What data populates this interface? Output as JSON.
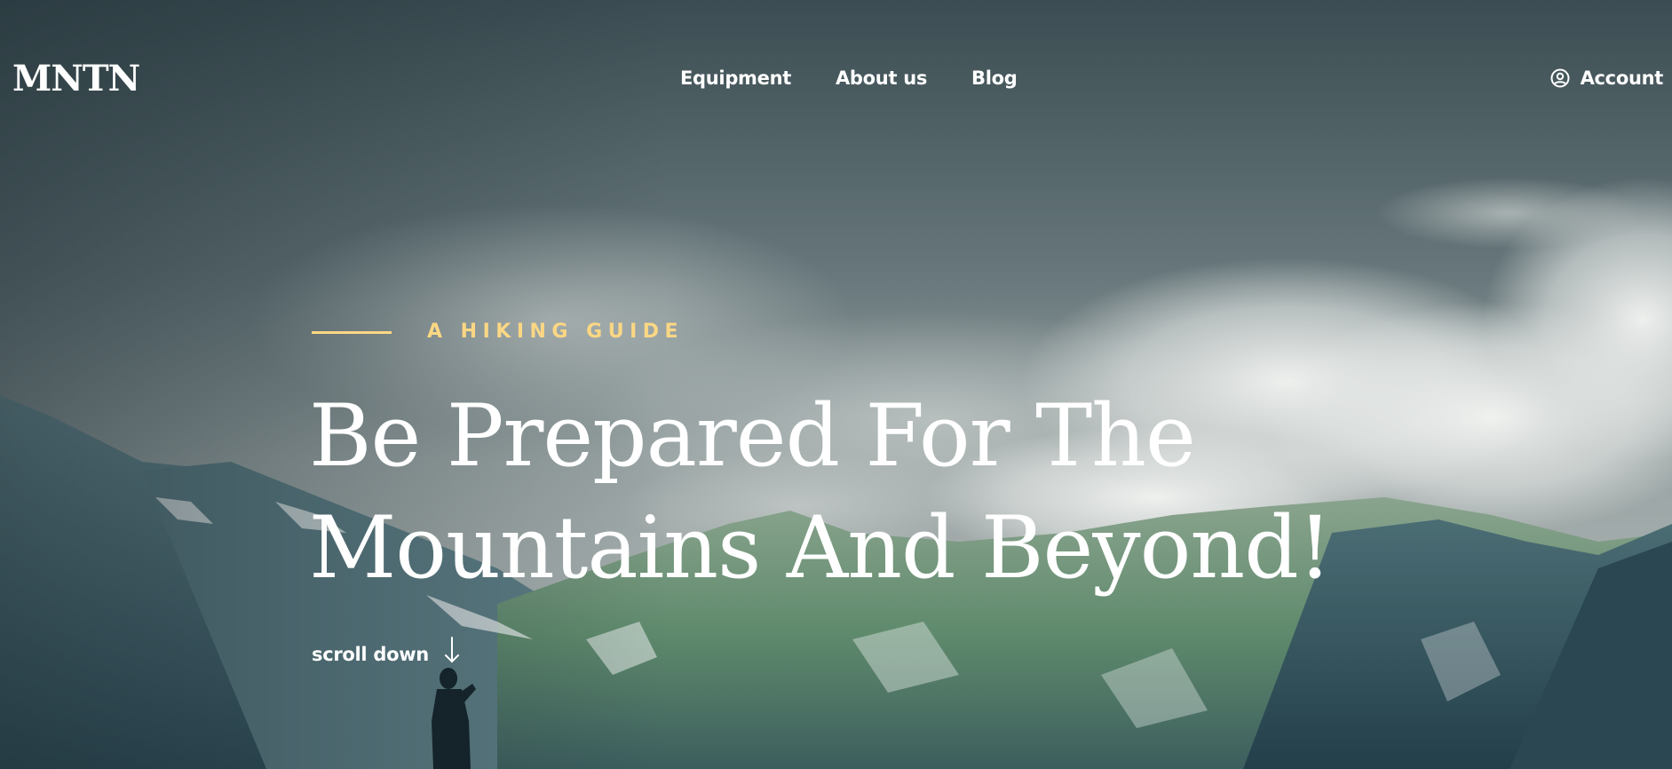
{
  "header": {
    "logo": "MNTN",
    "nav": [
      {
        "label": "Equipment"
      },
      {
        "label": "About us"
      },
      {
        "label": "Blog"
      }
    ],
    "account": {
      "label": "Account",
      "icon": "user-circle-icon"
    }
  },
  "hero": {
    "eyebrow": "A HIKING GUIDE",
    "title_line1": "Be Prepared For The",
    "title_line2": "Mountains And Beyond!",
    "scroll_label": "scroll down",
    "scroll_icon": "arrow-down-icon"
  },
  "colors": {
    "accent": "#fbd784",
    "text": "#ffffff",
    "sky_top": "#3f5358",
    "sky_mid": "#8a9798",
    "mountain_dark": "#31525c",
    "mountain_green": "#5f8a6c"
  }
}
